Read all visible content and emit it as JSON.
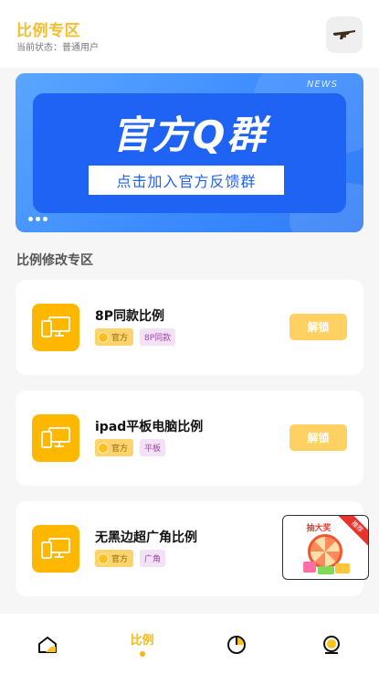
{
  "header": {
    "title": "比例专区",
    "status": "当前状态：普通用户",
    "action_icon": "rifle-icon"
  },
  "banner": {
    "news_label": "NEWS",
    "headline": "官方Q群",
    "cta": "点击加入官方反馈群"
  },
  "section": {
    "title": "比例修改专区"
  },
  "items": [
    {
      "name": "8P同款比例",
      "tag_official": "官方",
      "tag_type": "8P同款",
      "action": "解锁"
    },
    {
      "name": "ipad平板电脑比例",
      "tag_official": "官方",
      "tag_type": "平板",
      "action": "解锁"
    },
    {
      "name": "无黑边超广角比例",
      "tag_official": "官方",
      "tag_type": "广角"
    }
  ],
  "promo": {
    "title": "抽大奖",
    "ribbon": "推荐"
  },
  "tabbar": {
    "active_label": "比例",
    "tabs": [
      "home-icon",
      "比例",
      "pie-chart-icon",
      "profile-icon"
    ]
  },
  "colors": {
    "accent": "#f7b818",
    "banner_blue": "#1f63f5",
    "icon_bg": "#ffb700"
  }
}
